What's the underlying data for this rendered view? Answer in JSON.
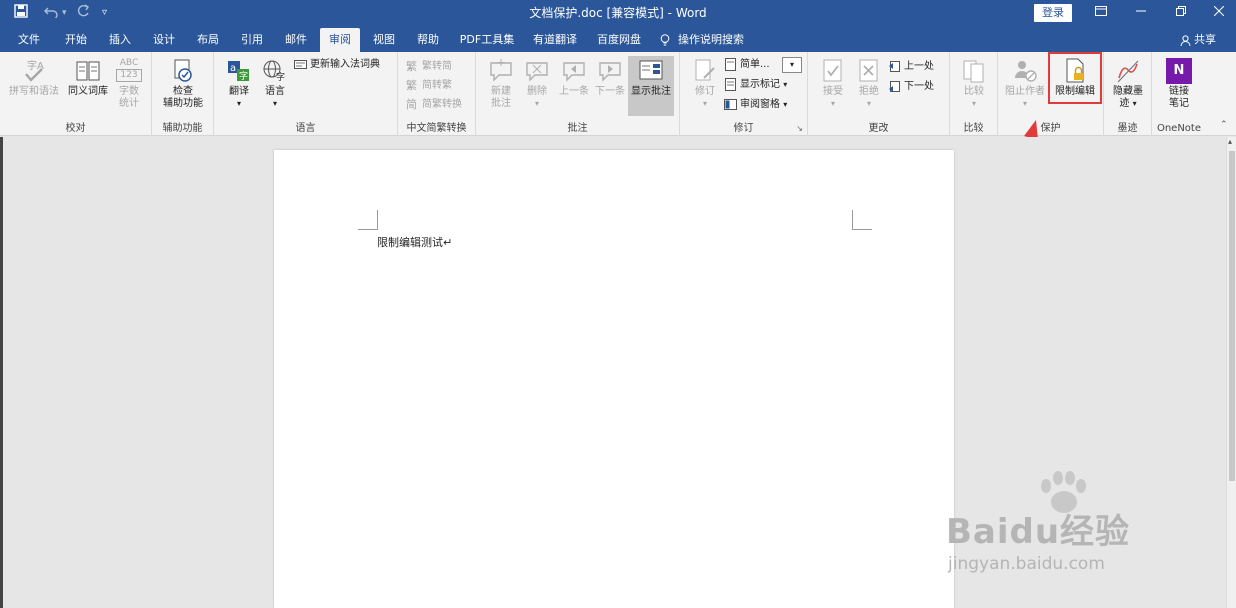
{
  "window": {
    "title": "文档保护.doc [兼容模式] - Word",
    "login": "登录"
  },
  "tabs": [
    "文件",
    "开始",
    "插入",
    "设计",
    "布局",
    "引用",
    "邮件",
    "审阅",
    "视图",
    "帮助",
    "PDF工具集",
    "有道翻译",
    "百度网盘"
  ],
  "active_tab": "审阅",
  "tell_me": "操作说明搜索",
  "share": "共享",
  "ribbon": {
    "proofing": {
      "spelling": "拼写和语法",
      "thesaurus": "同义词库",
      "wordcount_1": "字数",
      "wordcount_2": "统计",
      "wordcount_abc": "ABC",
      "wordcount_num": "123",
      "label": "校对"
    },
    "accessibility": {
      "check_1": "检查",
      "check_2": "辅助功能",
      "label": "辅助功能"
    },
    "language": {
      "translate": "翻译",
      "language": "语言",
      "update_ime": "更新输入法词典",
      "label": "语言"
    },
    "chinese": {
      "t2s": "繁转简",
      "s2t": "简转繁",
      "convert": "简繁转换",
      "label": "中文简繁转换"
    },
    "comments": {
      "new_1": "新建",
      "new_2": "批注",
      "delete": "删除",
      "prev": "上一条",
      "next": "下一条",
      "show": "显示批注",
      "label": "批注"
    },
    "tracking": {
      "track": "修订",
      "simple": "简单...",
      "markup": "显示标记",
      "pane": "审阅窗格",
      "label": "修订"
    },
    "changes": {
      "accept": "接受",
      "reject": "拒绝",
      "prev": "上一处",
      "next": "下一处",
      "label": "更改"
    },
    "compare": {
      "compare": "比较",
      "label": "比较"
    },
    "protect": {
      "block": "阻止作者",
      "restrict": "限制编辑",
      "label": "保护"
    },
    "ink": {
      "hide_1": "隐藏墨",
      "hide_2": "迹",
      "label": "墨迹"
    },
    "onenote": {
      "link_1": "链接",
      "link_2": "笔记",
      "label": "OneNote",
      "badge": "N"
    }
  },
  "document": {
    "text": "限制编辑测试↵"
  },
  "watermark": {
    "brand": "Baidu经验",
    "url": "jingyan.baidu.com"
  },
  "colors": {
    "titlebar": "#2b579a",
    "highlight": "#e03a3a",
    "ribbon": "#f3f3f3"
  }
}
